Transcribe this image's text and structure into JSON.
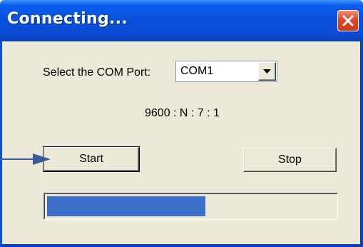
{
  "window": {
    "title": "Connecting..."
  },
  "form": {
    "com_port_label": "Select the COM Port:",
    "com_port_value": "COM1",
    "serial_settings": "9600 : N : 7 : 1"
  },
  "buttons": {
    "start_label": "Start",
    "stop_label": "Stop"
  },
  "progress": {
    "fraction": 0.55
  },
  "colors": {
    "titlebar": "#0a52d6",
    "progress_fill": "#3a6ec8",
    "arrow": "#3c5a9a",
    "close_button": "#e0492a"
  }
}
